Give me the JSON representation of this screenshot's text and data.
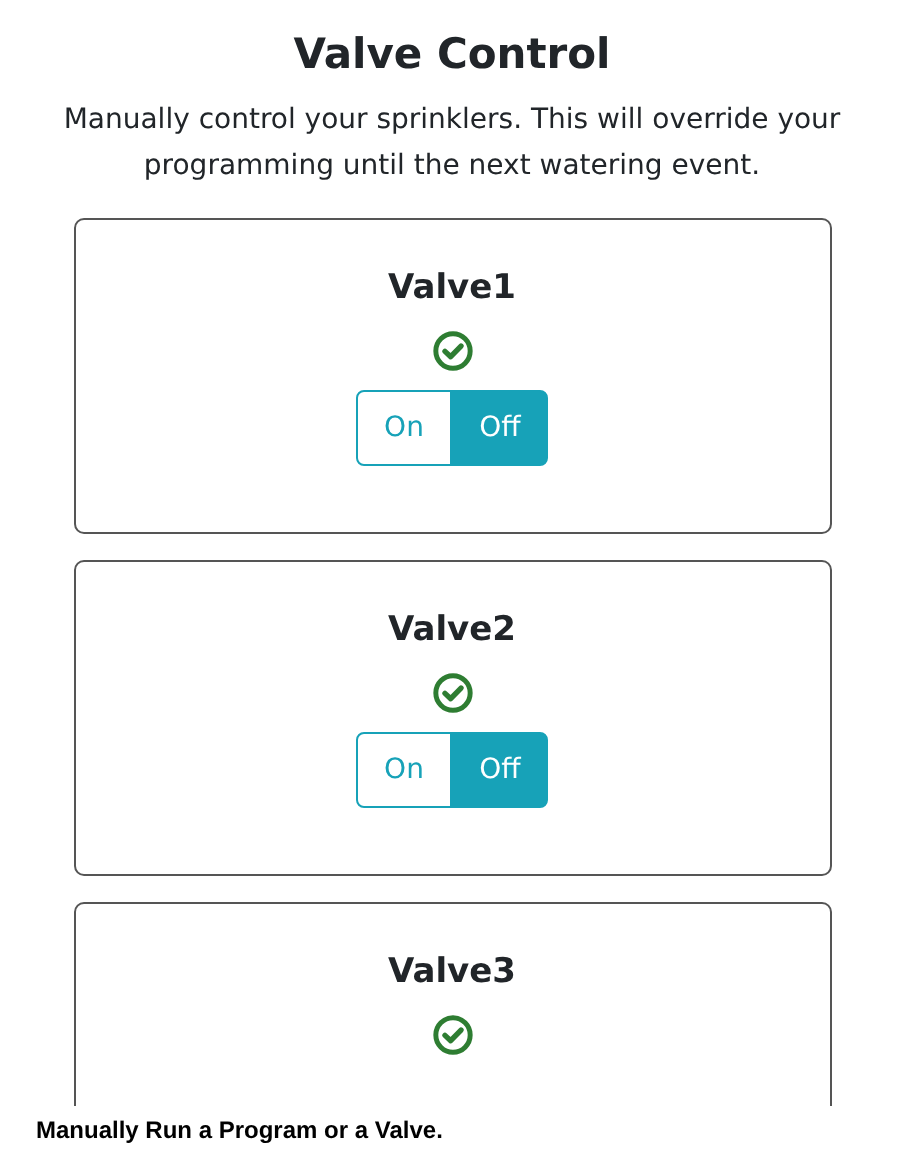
{
  "title": "Valve Control",
  "description": "Manually control your sprinklers. This will override your programming until the next watering event.",
  "valves": [
    {
      "name": "Valve1",
      "options": [
        {
          "label": "On",
          "selected": false
        },
        {
          "label": "Off",
          "selected": true
        }
      ]
    },
    {
      "name": "Valve2",
      "options": [
        {
          "label": "On",
          "selected": false
        },
        {
          "label": "Off",
          "selected": true
        }
      ]
    },
    {
      "name": "Valve3"
    }
  ],
  "caption": "Manually Run a Program or a Valve."
}
